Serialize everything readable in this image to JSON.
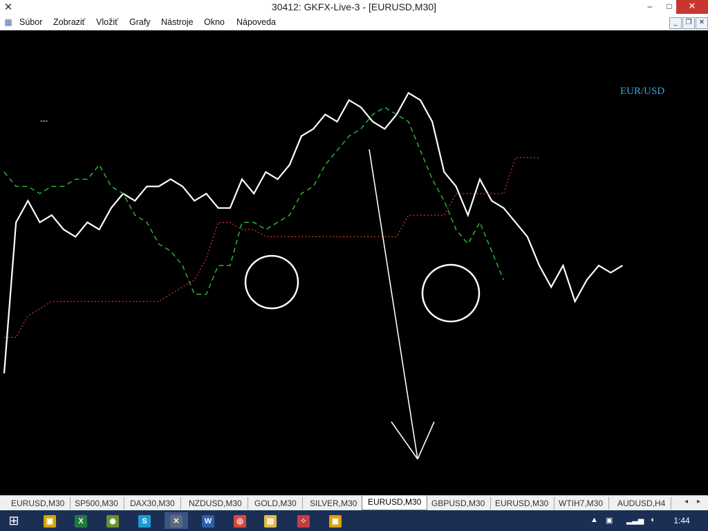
{
  "window": {
    "title": "30412: GKFX-Live-3 - [EURUSD,M30]",
    "app_icon": "mt4-app-icon",
    "controls": {
      "minimize": "–",
      "maximize": "□",
      "close": "✕"
    }
  },
  "menu": {
    "doc_icon": "chart-document-icon",
    "items": [
      "Súbor",
      "Zobraziť",
      "Vložiť",
      "Grafy",
      "Nástroje",
      "Okno",
      "Nápoveda"
    ],
    "mdi_controls": {
      "minimize": "_",
      "restore": "❐",
      "close": "✕"
    }
  },
  "chart": {
    "symbol_label": "EUR/USD",
    "dash_label": "---",
    "colors": {
      "background": "#000000",
      "price_line": "#ffffff",
      "lagging_span": "#2fbf3a",
      "baseline": "#e03c2c",
      "label": "#3ba7e0",
      "annotation": "#ffffff"
    },
    "annotations": [
      "circle",
      "circle",
      "down-arrow"
    ]
  },
  "chart_data": {
    "type": "line",
    "title": "EUR/USD",
    "note": "Chart shows lines only; no axis values or price scale are printed.",
    "series": [
      {
        "name": "",
        "style": "solid-white",
        "x": [
          0,
          2,
          4,
          6,
          8,
          10,
          12,
          14,
          16,
          18,
          20,
          22,
          24,
          26,
          28,
          30,
          32,
          34,
          36,
          38,
          40,
          42,
          44,
          46,
          48,
          50,
          52,
          54,
          56,
          58,
          60,
          62,
          64,
          66,
          68,
          70,
          72,
          74,
          76,
          78,
          80,
          82,
          84,
          86,
          88,
          90,
          92,
          94,
          96,
          98,
          100,
          102,
          104
        ],
        "y": [
          20,
          62,
          68,
          62,
          64,
          60,
          58,
          62,
          60,
          66,
          70,
          68,
          72,
          72,
          74,
          72,
          68,
          70,
          66,
          66,
          74,
          70,
          76,
          74,
          78,
          86,
          88,
          92,
          90,
          96,
          94,
          90,
          88,
          92,
          98,
          96,
          90,
          76,
          72,
          64,
          74,
          68,
          66,
          62,
          58,
          50,
          44,
          50,
          40,
          46,
          50,
          48,
          50
        ]
      },
      {
        "name": "",
        "style": "dashed-green",
        "x": [
          0,
          2,
          4,
          6,
          8,
          10,
          12,
          14,
          16,
          18,
          20,
          22,
          24,
          26,
          28,
          30,
          32,
          34,
          36,
          38,
          40,
          42,
          44,
          46,
          48,
          50,
          52,
          54,
          56,
          58,
          60,
          62,
          64,
          66,
          68,
          70,
          72,
          74,
          76,
          78,
          80,
          82,
          84
        ],
        "y": [
          76,
          72,
          72,
          70,
          72,
          72,
          74,
          74,
          78,
          72,
          70,
          64,
          62,
          56,
          54,
          50,
          42,
          42,
          50,
          50,
          62,
          62,
          60,
          62,
          64,
          70,
          72,
          78,
          82,
          86,
          88,
          92,
          94,
          92,
          90,
          82,
          74,
          68,
          60,
          56,
          62,
          54,
          46
        ]
      },
      {
        "name": "",
        "style": "dotted-red",
        "x": [
          0,
          2,
          4,
          6,
          8,
          10,
          12,
          14,
          16,
          18,
          20,
          22,
          24,
          26,
          28,
          30,
          32,
          34,
          36,
          38,
          40,
          42,
          44,
          46,
          48,
          50,
          52,
          54,
          56,
          58,
          60,
          62,
          64,
          66,
          68,
          70,
          72,
          74,
          76,
          78,
          80,
          82,
          84,
          86,
          88,
          90
        ],
        "y": [
          30,
          30,
          36,
          38,
          40,
          40,
          40,
          40,
          40,
          40,
          40,
          40,
          40,
          40,
          42,
          44,
          46,
          52,
          62,
          62,
          60,
          60,
          58,
          58,
          58,
          58,
          58,
          58,
          58,
          58,
          58,
          58,
          58,
          58,
          64,
          64,
          64,
          64,
          70,
          70,
          70,
          70,
          70,
          80,
          80,
          80
        ]
      }
    ],
    "ylim": [
      0,
      100
    ],
    "grid": false,
    "legend": "none"
  },
  "tabs": {
    "items": [
      "EURUSD,M30",
      "SP500,M30",
      "DAX30,M30",
      "NZDUSD,M30",
      "GOLD,M30",
      "SILVER,M30",
      "EURUSD,M30",
      "GBPUSD,M30",
      "EURUSD,M30",
      "WTIH7,M30",
      "AUDUSD,H4"
    ],
    "active_index": 6,
    "scroll_left": "◂",
    "scroll_right": "▸"
  },
  "taskbar": {
    "start_icon": "windows-start-icon",
    "apps": [
      {
        "name": "file-manager-icon",
        "glyph": "▣",
        "color": "#d9a400"
      },
      {
        "name": "excel-icon",
        "glyph": "X",
        "color": "#1f7a3f"
      },
      {
        "name": "globe-app-icon",
        "glyph": "◉",
        "color": "#6a8f2f"
      },
      {
        "name": "skype-icon",
        "glyph": "S",
        "color": "#1a9bd7"
      },
      {
        "name": "metatrader-icon",
        "glyph": "✕",
        "color": "#5c6a80"
      },
      {
        "name": "word-icon",
        "glyph": "W",
        "color": "#2b5fad"
      },
      {
        "name": "chrome-icon",
        "glyph": "◎",
        "color": "#d34b3c"
      },
      {
        "name": "folder-icon",
        "glyph": "▤",
        "color": "#e0b94a"
      },
      {
        "name": "dots-app-icon",
        "glyph": "⁘",
        "color": "#c33f3f"
      },
      {
        "name": "screen-app-icon",
        "glyph": "▣",
        "color": "#d9a400"
      }
    ],
    "tray": {
      "up_arrow": "▲",
      "time": "1:44"
    }
  }
}
